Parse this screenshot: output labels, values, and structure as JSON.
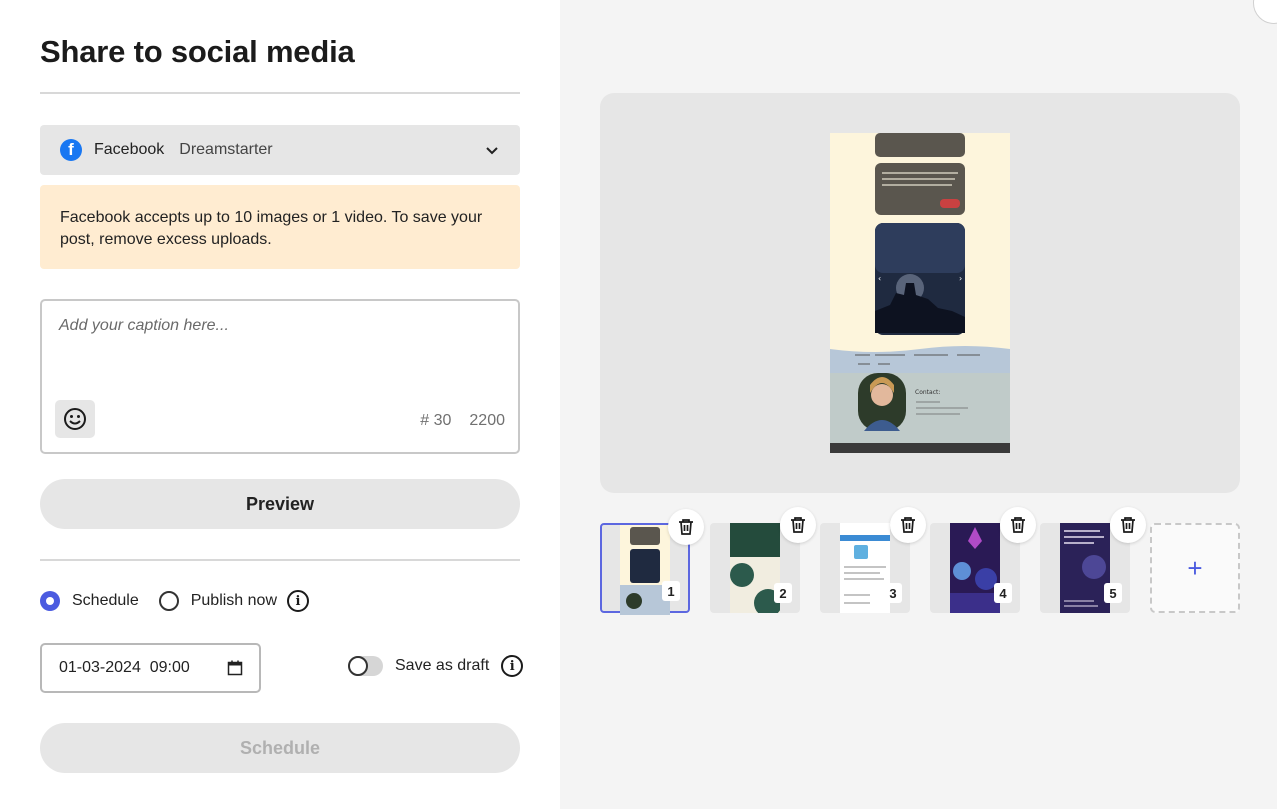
{
  "dialog": {
    "title": "Share to social media"
  },
  "account": {
    "platform": "Facebook",
    "name": "Dreamstarter",
    "icon": "facebook-icon"
  },
  "warning": {
    "text": "Facebook accepts up to 10 images or 1 video. To save your post, remove excess uploads."
  },
  "caption": {
    "value": "",
    "placeholder": "Add your caption here...",
    "hashtag_count": "# 30",
    "char_limit": "2200"
  },
  "preview_button": {
    "label": "Preview"
  },
  "publish": {
    "schedule_label": "Schedule",
    "publish_now_label": "Publish now",
    "selected": "Schedule"
  },
  "datetime": {
    "value": "01-03-2024  09:00"
  },
  "draft": {
    "label": "Save as draft",
    "enabled": false
  },
  "schedule_button": {
    "label": "Schedule",
    "disabled": true
  },
  "thumbnails": [
    {
      "number": "1",
      "selected": true
    },
    {
      "number": "2",
      "selected": false
    },
    {
      "number": "3",
      "selected": false
    },
    {
      "number": "4",
      "selected": false
    },
    {
      "number": "5",
      "selected": false
    }
  ],
  "add_media": {
    "label": "+"
  },
  "colors": {
    "accent": "#4b5be0",
    "warning_bg": "#ffecd1",
    "facebook": "#1877f2",
    "panel_bg": "#f4f4f4"
  }
}
